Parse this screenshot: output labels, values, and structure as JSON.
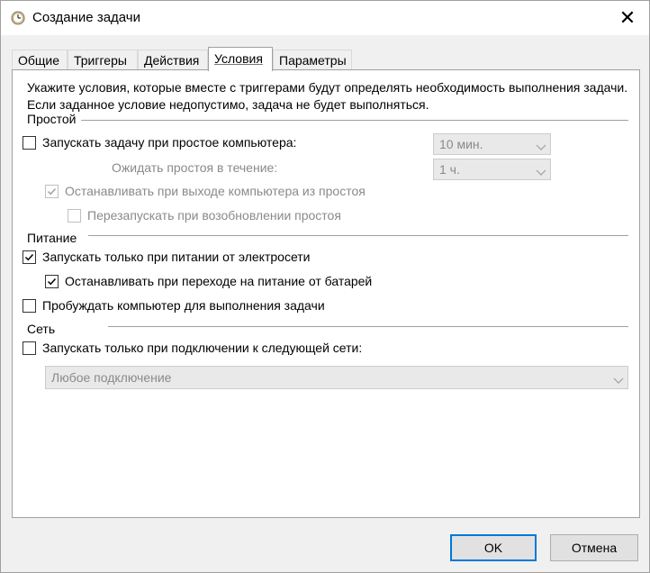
{
  "window": {
    "title": "Создание задачи",
    "close_glyph": "✕",
    "icon": "task-scheduler-clock-icon"
  },
  "tabs": [
    {
      "label": "Общие",
      "active": false
    },
    {
      "label": "Триггеры",
      "active": false
    },
    {
      "label": "Действия",
      "active": false
    },
    {
      "label": "Условия",
      "active": true
    },
    {
      "label": "Параметры",
      "active": false
    }
  ],
  "conditions": {
    "description": "Укажите условия, которые вместе с триггерами будут определять необходимость выполнения задачи.  Если заданное условие недопустимо, задача не будет выполняться.",
    "idle": {
      "title": "Простой",
      "start_on_idle": {
        "label": "Запускать задачу при простое компьютера:",
        "checked": false
      },
      "idle_duration_value": "10 мин.",
      "wait_label": "Ожидать простоя в течение:",
      "wait_value": "1 ч.",
      "stop_on_idle_end": {
        "label": "Останавливать при выходе компьютера из простоя",
        "checked": true,
        "enabled": false
      },
      "restart_on_idle": {
        "label": "Перезапускать при возобновлении простоя",
        "checked": false,
        "enabled": false
      }
    },
    "power": {
      "title": "Питание",
      "ac_only": {
        "label": "Запускать только при питании от электросети",
        "checked": true
      },
      "stop_on_battery": {
        "label": "Останавливать при переходе на питание от батарей",
        "checked": true
      },
      "wake_to_run": {
        "label": "Пробуждать компьютер для выполнения задачи",
        "checked": false
      }
    },
    "network": {
      "title": "Сеть",
      "network_only": {
        "label": "Запускать только при подключении к следующей сети:",
        "checked": false
      },
      "network_value": "Любое подключение"
    }
  },
  "buttons": {
    "ok": "OK",
    "cancel": "Отмена"
  },
  "colors": {
    "accent": "#0078d7",
    "disabled_text": "#8a8a8a",
    "panel_bg": "#ffffff",
    "window_bg": "#f0f0f0"
  }
}
